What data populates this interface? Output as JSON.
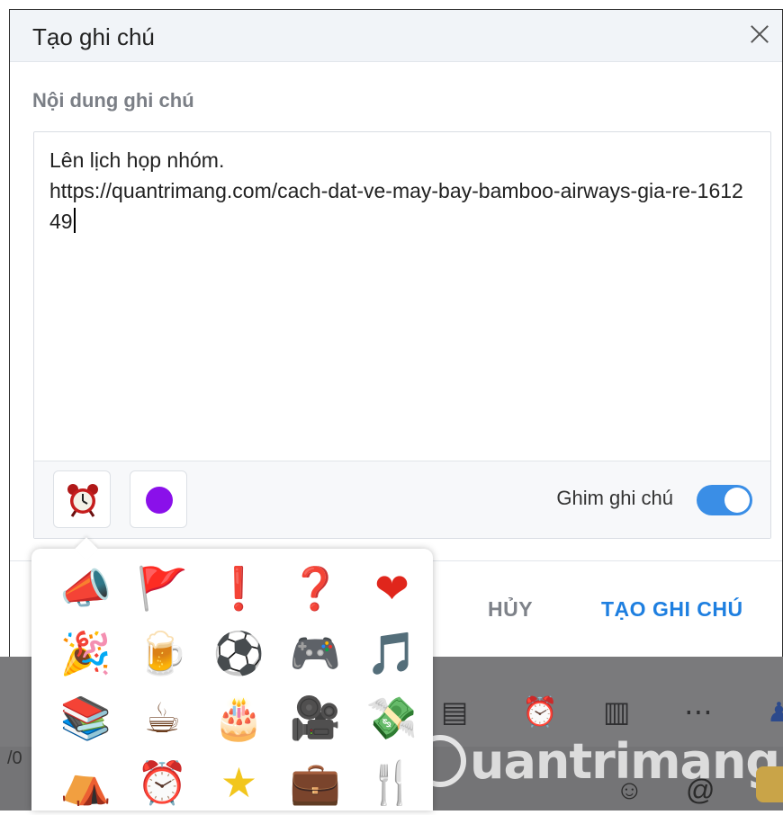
{
  "dialog": {
    "title": "Tạo ghi chú",
    "close_label": "×"
  },
  "note": {
    "section_label": "Nội dung ghi chú",
    "text": "Lên lịch họp nhóm.\nhttps://quantrimang.com/cach-dat-ve-may-bay-bamboo-airways-gia-re-161249"
  },
  "toolbar": {
    "emoji_icon": "alarm-clock-icon",
    "color_value": "#8a10ea",
    "pin_label": "Ghim ghi chú",
    "pin_enabled": true
  },
  "footer": {
    "cancel_label": "HỦY",
    "create_label": "TẠO GHI CHÚ"
  },
  "emoji_picker": {
    "items": [
      {
        "name": "megaphone-icon",
        "glyph": "📣"
      },
      {
        "name": "flag-icon",
        "glyph": "🚩"
      },
      {
        "name": "exclamation-icon",
        "glyph": "❗"
      },
      {
        "name": "question-icon",
        "glyph": "❓"
      },
      {
        "name": "heart-icon",
        "glyph": "❤"
      },
      {
        "name": "party-popper-icon",
        "glyph": "🎉"
      },
      {
        "name": "beer-icon",
        "glyph": "🍺"
      },
      {
        "name": "soccer-ball-icon",
        "glyph": "⚽"
      },
      {
        "name": "game-controller-icon",
        "glyph": "🎮"
      },
      {
        "name": "headphones-music-icon",
        "glyph": "🎵"
      },
      {
        "name": "books-icon",
        "glyph": "📚"
      },
      {
        "name": "coffee-icon",
        "glyph": "☕"
      },
      {
        "name": "birthday-cake-icon",
        "glyph": "🎂"
      },
      {
        "name": "movie-camera-icon",
        "glyph": "🎥"
      },
      {
        "name": "money-wings-icon",
        "glyph": "💸"
      },
      {
        "name": "camping-icon",
        "glyph": "⛺"
      },
      {
        "name": "alarm-clock-icon",
        "glyph": "⏰"
      },
      {
        "name": "star-icon",
        "glyph": "★"
      },
      {
        "name": "briefcase-icon",
        "glyph": "💼"
      },
      {
        "name": "fork-knife-icon",
        "glyph": "🍴"
      }
    ]
  },
  "background": {
    "watermark": "uantrimang",
    "fragment": "/0"
  }
}
